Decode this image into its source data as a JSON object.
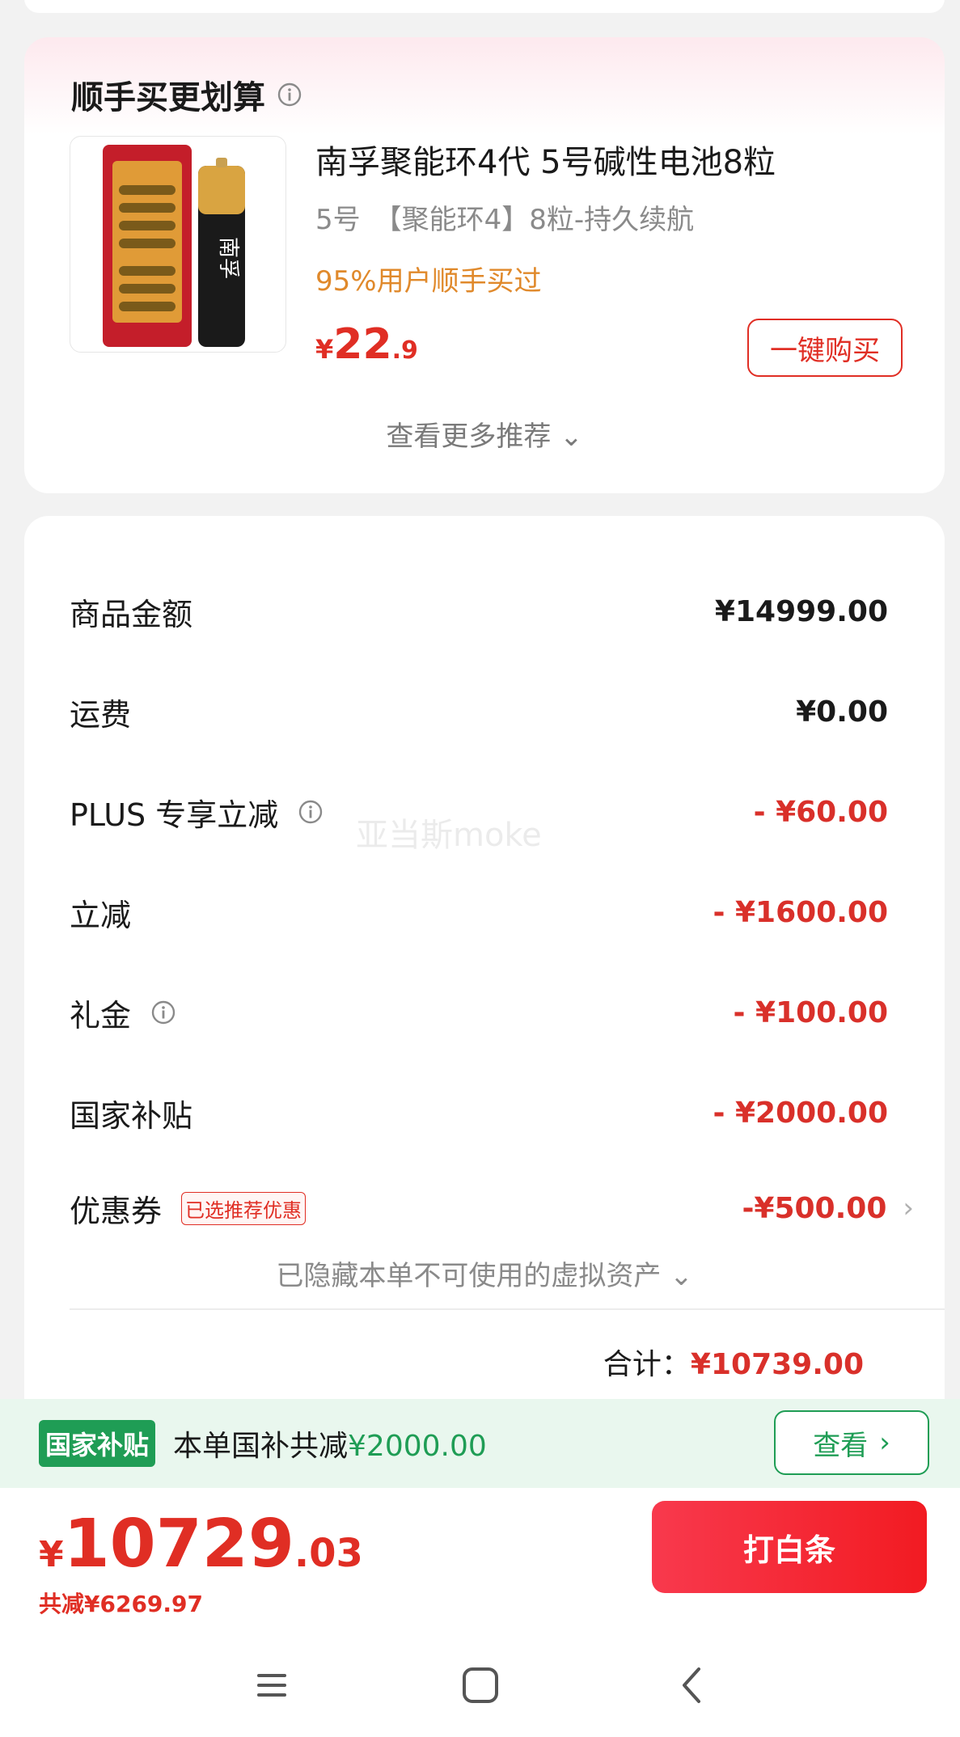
{
  "reco": {
    "title": "顺手买更划算",
    "product": {
      "name": "南孚聚能环4代 5号碱性电池8粒",
      "spec": "5号　【聚能环4】8粒-持久续航",
      "hint": "95%用户顺手买过",
      "price_currency": "¥",
      "price_int": "22",
      "price_dec": ".9",
      "buy_label": "一键购买",
      "image_brand": "南孚"
    },
    "more_label": "查看更多推荐 ⌄"
  },
  "bill": {
    "rows": [
      {
        "label": "商品金额",
        "value": "¥14999.00"
      },
      {
        "label": "运费",
        "value": "¥0.00"
      },
      {
        "label": "PLUS 专享立减",
        "value": "- ¥60.00"
      },
      {
        "label": "立减",
        "value": "- ¥1600.00"
      },
      {
        "label": "礼金",
        "value": "- ¥100.00"
      },
      {
        "label": "国家补贴",
        "value": "- ¥2000.00"
      },
      {
        "label": "优惠券",
        "value": "-¥500.00",
        "tag": "已选推荐优惠"
      }
    ],
    "hidden_assets": "已隐藏本单不可使用的虚拟资产 ⌄",
    "total_label": "合计：",
    "total_value": "¥10739.00"
  },
  "watermark": "亚当斯moke",
  "subsidy": {
    "badge": "国家补贴",
    "text": "本单国补共减",
    "amount": "¥2000.00",
    "view_label": "查看",
    "view_chevron": "›"
  },
  "footer": {
    "currency": "¥",
    "price_int": "10729",
    "price_dec": ".03",
    "saved": "共减¥6269.97",
    "pay_label": "打白条"
  },
  "colors": {
    "accent_red": "#e02e24",
    "subsidy_green": "#1f9d55"
  },
  "icons": [
    "info-icon",
    "chevron-down-icon",
    "chevron-right-icon",
    "menu-icon",
    "home-icon",
    "back-icon"
  ]
}
